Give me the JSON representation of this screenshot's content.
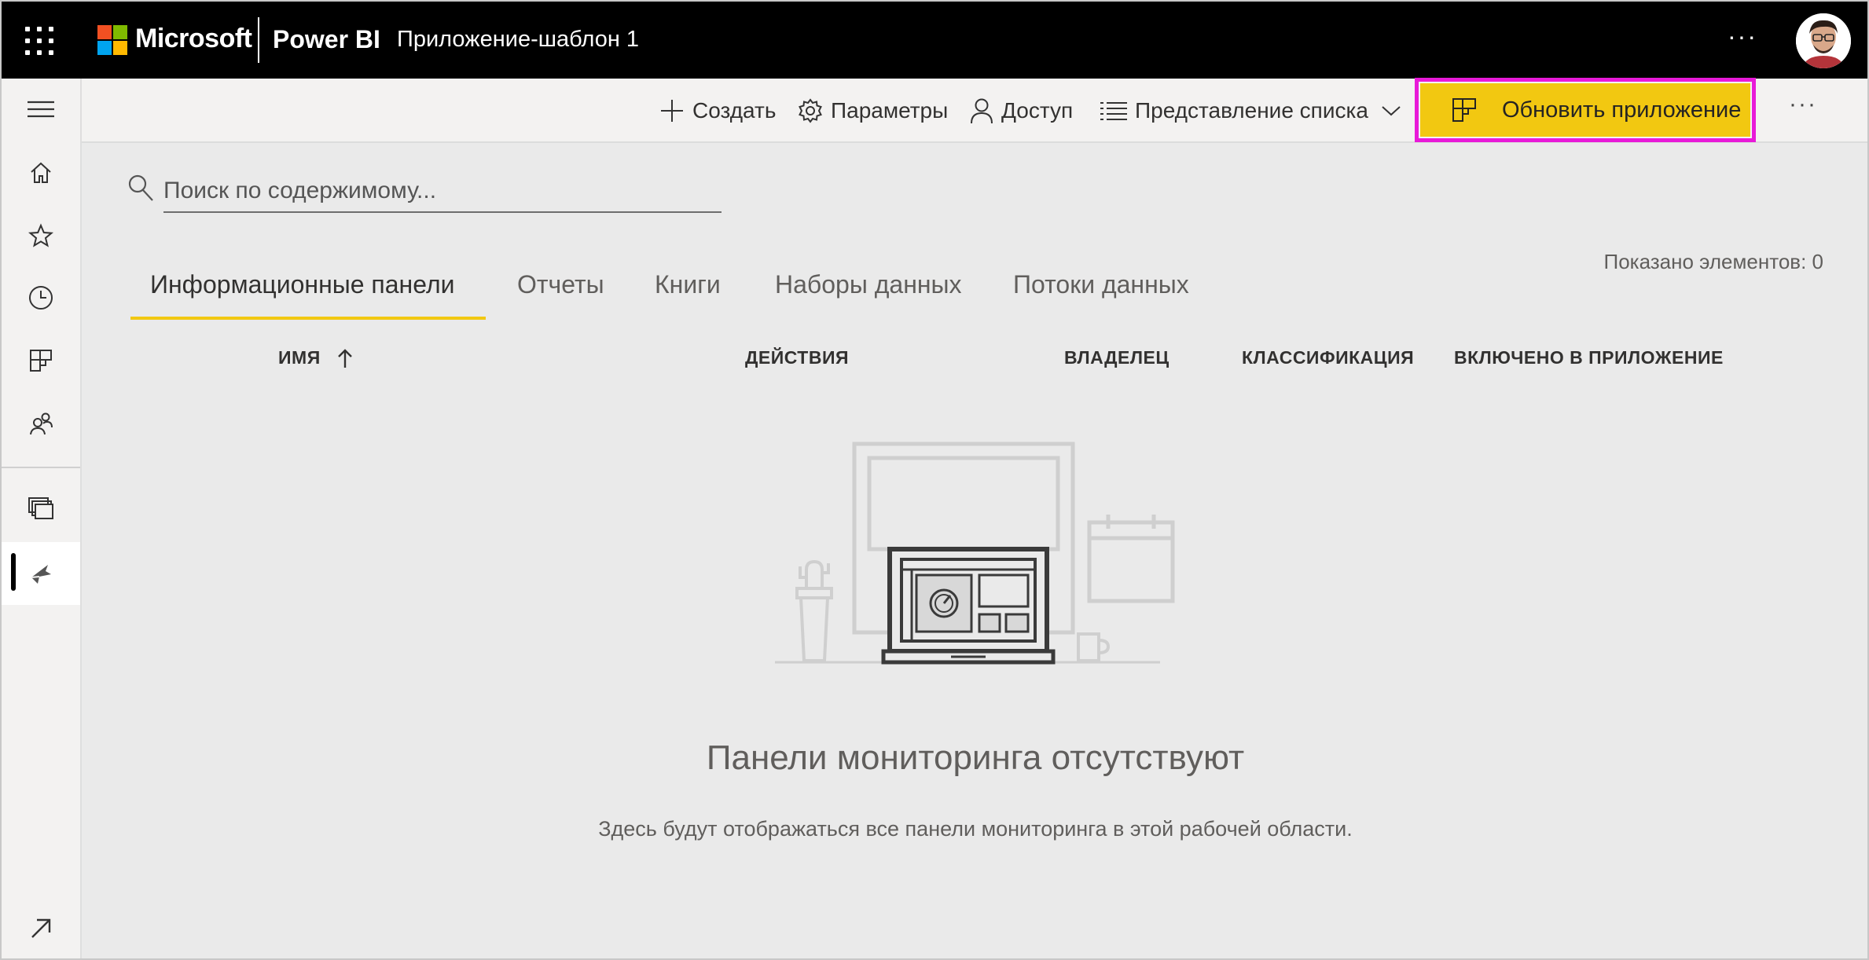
{
  "header": {
    "brand": "Microsoft",
    "product": "Power BI",
    "app_title": "Приложение-шаблон 1",
    "more": "···"
  },
  "toolbar": {
    "create": "Создать",
    "settings": "Параметры",
    "access": "Доступ",
    "view": "Представление списка",
    "update_app": "Обновить приложение",
    "more": "···"
  },
  "search": {
    "placeholder": "Поиск по содержимому..."
  },
  "count_label": "Показано элементов: 0",
  "tabs": [
    {
      "label": "Информационные панели",
      "active": true
    },
    {
      "label": "Отчеты"
    },
    {
      "label": "Книги"
    },
    {
      "label": "Наборы данных"
    },
    {
      "label": "Потоки данных"
    }
  ],
  "columns": {
    "name": "ИМЯ",
    "actions": "ДЕЙСТВИЯ",
    "owner": "ВЛАДЕЛЕЦ",
    "classification": "КЛАССИФИКАЦИЯ",
    "included": "ВКЛЮЧЕНО В ПРИЛОЖЕНИЕ"
  },
  "empty_state": {
    "title": "Панели мониторинга отсутствуют",
    "description": "Здесь будут отображаться все панели мониторинга в этой рабочей области."
  },
  "colors": {
    "accent_yellow": "#f2c811",
    "highlight_magenta": "#e81ad8",
    "topbar": "#000000"
  }
}
